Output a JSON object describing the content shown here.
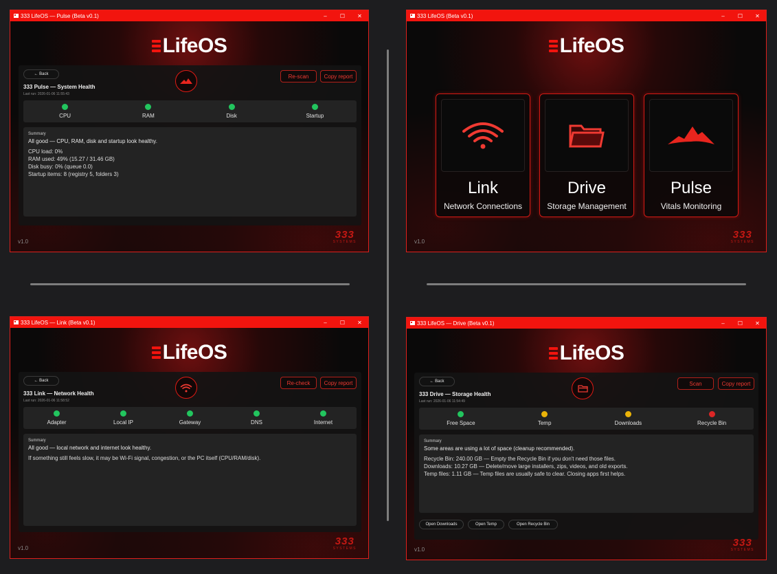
{
  "common": {
    "logo": "LifeOS",
    "version": "v1.0",
    "brand_num": "333",
    "brand_sub": "SYSTEMS",
    "back": "← Back",
    "summary_heading": "Summary",
    "minimize": "–",
    "maximize": "☐",
    "close": "✕"
  },
  "pulse": {
    "window_title": "333 LifeOS — Pulse (Beta v0.1)",
    "title": "333 Pulse — System Health",
    "last_run": "Last run: 2026-01-06 11:55:43",
    "btn1": "Re-scan",
    "btn2": "Copy report",
    "status": [
      {
        "label": "CPU",
        "color": "#22c55e"
      },
      {
        "label": "RAM",
        "color": "#22c55e"
      },
      {
        "label": "Disk",
        "color": "#22c55e"
      },
      {
        "label": "Startup",
        "color": "#22c55e"
      }
    ],
    "summary_main": "All good — CPU, RAM, disk and startup look healthy.",
    "lines": [
      "CPU load: 0%",
      "RAM used: 49% (15.27 / 31.46 GB)",
      "Disk busy: 0% (queue 0.0)",
      "Startup items: 8 (registry 5, folders 3)"
    ]
  },
  "hub": {
    "window_title": "333 LifeOS (Beta v0.1)",
    "cards": [
      {
        "name": "Link",
        "sub": "Network Connections",
        "icon": "wifi-icon"
      },
      {
        "name": "Drive",
        "sub": "Storage Management",
        "icon": "folder-icon"
      },
      {
        "name": "Pulse",
        "sub": "Vitals Monitoring",
        "icon": "pulse-icon"
      }
    ]
  },
  "link": {
    "window_title": "333 LifeOS — Link (Beta v0.1)",
    "title": "333 Link — Network Health",
    "last_run": "Last run: 2026-01-06 11:58:52",
    "btn1": "Re-check",
    "btn2": "Copy report",
    "status": [
      {
        "label": "Adapter",
        "color": "#22c55e"
      },
      {
        "label": "Local IP",
        "color": "#22c55e"
      },
      {
        "label": "Gateway",
        "color": "#22c55e"
      },
      {
        "label": "DNS",
        "color": "#22c55e"
      },
      {
        "label": "Internet",
        "color": "#22c55e"
      }
    ],
    "summary_main": "All good — local network and internet look healthy.",
    "lines": [
      "If something still feels slow, it may be Wi-Fi signal, congestion, or the PC itself (CPU/RAM/disk)."
    ]
  },
  "drive": {
    "window_title": "333 LifeOS — Drive (Beta v0.1)",
    "title": "333 Drive — Storage Health",
    "last_run": "Last run: 2026-01-06 11:54:49",
    "btn1": "Scan",
    "btn2": "Copy report",
    "status": [
      {
        "label": "Free Space",
        "color": "#22c55e"
      },
      {
        "label": "Temp",
        "color": "#eab308"
      },
      {
        "label": "Downloads",
        "color": "#eab308"
      },
      {
        "label": "Recycle Bin",
        "color": "#dc2626"
      }
    ],
    "summary_main": "Some areas are using a lot of space (cleanup recommended).",
    "lines": [
      "Recycle Bin: 240.00 GB — Empty the Recycle Bin if you don't need those files.",
      "Downloads: 10.27 GB — Delete/move large installers, zips, videos, and old exports.",
      "Temp files: 1.11 GB — Temp files are usually safe to clear. Closing apps first helps."
    ],
    "open_downloads": "Open Downloads",
    "open_temp": "Open Temp",
    "open_recycle": "Open Recycle Bin"
  },
  "colors": {
    "accent": "#f2140e",
    "ok": "#22c55e",
    "warn": "#eab308",
    "bad": "#dc2626"
  }
}
